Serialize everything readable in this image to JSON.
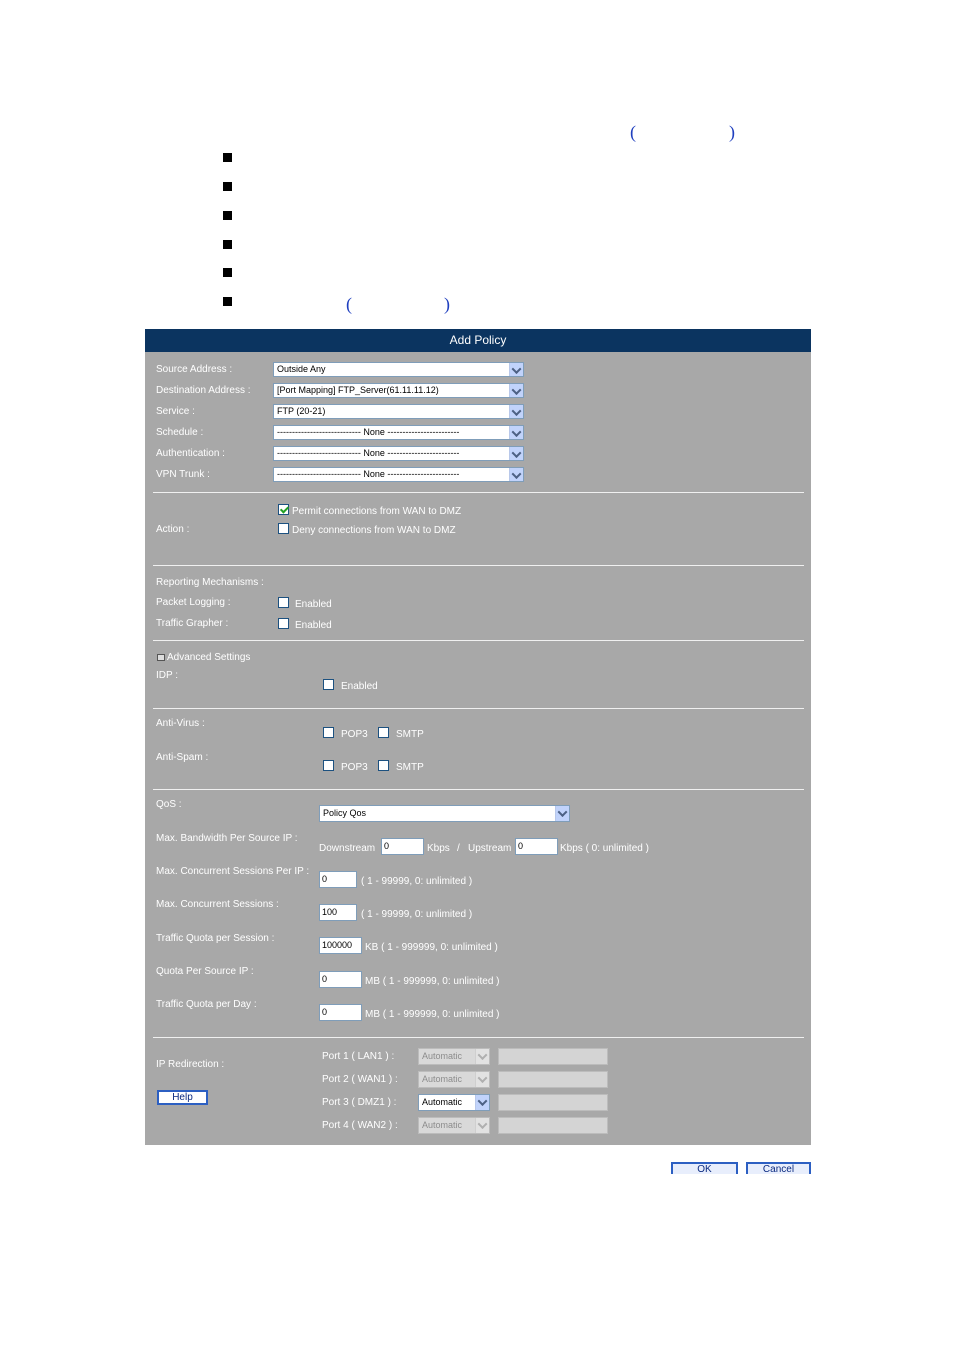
{
  "panel": {
    "title": "Add Policy",
    "basic": {
      "source_address": {
        "label": "Source Address :",
        "value": "Outside Any"
      },
      "destination_address": {
        "label": "Destination Address :",
        "value": "[Port Mapping] FTP_Server(61.11.11.12)"
      },
      "service": {
        "label": "Service :",
        "value": "FTP (20-21)"
      },
      "schedule": {
        "label": "Schedule :",
        "value": "---------------------------- None ------------------------"
      },
      "authentication": {
        "label": "Authentication :",
        "value": "---------------------------- None ------------------------"
      },
      "vpn_trunk": {
        "label": "VPN Trunk :",
        "value": "---------------------------- None ------------------------"
      }
    },
    "action": {
      "label": "Action :",
      "permit": {
        "label": "Permit connections from WAN to DMZ",
        "checked": true
      },
      "deny": {
        "label": "Deny connections from WAN to DMZ",
        "checked": false
      }
    },
    "reporting": {
      "label": "Reporting Mechanisms :",
      "packet_logging": {
        "label": "Packet Logging :",
        "option": "Enabled"
      },
      "traffic_grapher": {
        "label": "Traffic Grapher :",
        "option": "Enabled"
      }
    },
    "advanced": {
      "label": "Advanced Settings",
      "idp": {
        "label": "IDP :",
        "option": "Enabled"
      },
      "anti_virus": {
        "label": "Anti-Virus :",
        "pop3": "POP3",
        "smtp": "SMTP"
      },
      "anti_spam": {
        "label": "Anti-Spam :",
        "pop3": "POP3",
        "smtp": "SMTP"
      }
    },
    "qos": {
      "label": "QoS :",
      "value": "Policy Qos",
      "bandwidth": {
        "label": "Max. Bandwidth Per Source IP :",
        "downstream_label": "Downstream",
        "downstream_value": "0",
        "kbps": "Kbps",
        "slash": "/",
        "upstream_label": "Upstream",
        "upstream_value": "0",
        "upstream_unit": "Kbps ( 0: unlimited )"
      },
      "sessions_per_ip": {
        "label": "Max. Concurrent Sessions Per IP :",
        "value": "0",
        "hint": "( 1 - 99999, 0: unlimited )"
      },
      "sessions": {
        "label": "Max. Concurrent Sessions :",
        "value": "100",
        "hint": "( 1 - 99999, 0: unlimited )"
      },
      "quota_session": {
        "label": "Traffic Quota per Session :",
        "value": "100000",
        "hint": "KB ( 1 - 999999, 0: unlimited )"
      },
      "quota_source": {
        "label": "Quota Per Source IP :",
        "value": "0",
        "hint": "MB ( 1 - 999999, 0: unlimited )"
      },
      "quota_day": {
        "label": "Traffic Quota per Day :",
        "value": "0",
        "hint": "MB ( 1 - 999999, 0: unlimited )"
      }
    },
    "redirection": {
      "label": "IP Redirection :",
      "help": "Help",
      "ports": [
        {
          "label": "Port 1 ( LAN1 ) :",
          "value": "Automatic",
          "enabled": false
        },
        {
          "label": "Port 2 ( WAN1 ) :",
          "value": "Automatic",
          "enabled": false
        },
        {
          "label": "Port 3 ( DMZ1 ) :",
          "value": "Automatic",
          "enabled": true
        },
        {
          "label": "Port 4 ( WAN2 ) :",
          "value": "Automatic",
          "enabled": false
        }
      ]
    }
  },
  "buttons": {
    "ok": "OK",
    "cancel": "Cancel"
  },
  "colors": {
    "header": "#0b3460",
    "panel": "#a8a8a8",
    "paren": "#1f3fbf"
  }
}
